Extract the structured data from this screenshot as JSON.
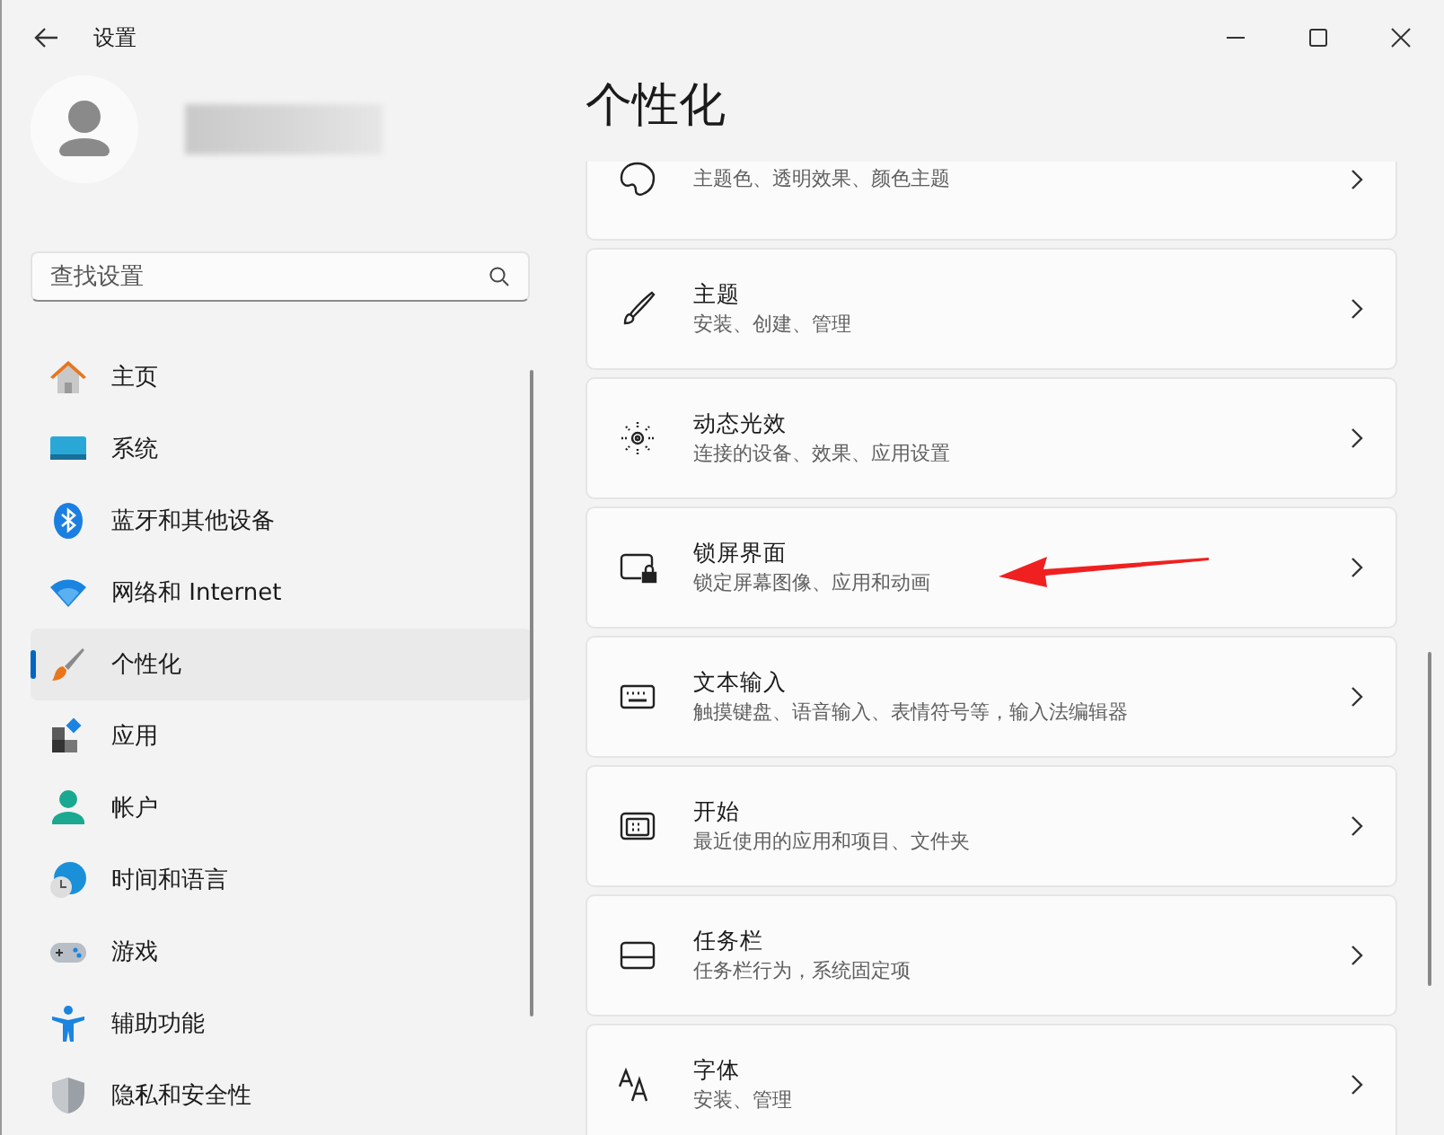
{
  "window": {
    "title": "设置"
  },
  "search": {
    "placeholder": "查找设置"
  },
  "sidebar": {
    "items": [
      {
        "label": "主页",
        "selected": false
      },
      {
        "label": "系统",
        "selected": false
      },
      {
        "label": "蓝牙和其他设备",
        "selected": false
      },
      {
        "label": "网络和 Internet",
        "selected": false
      },
      {
        "label": "个性化",
        "selected": true
      },
      {
        "label": "应用",
        "selected": false
      },
      {
        "label": "帐户",
        "selected": false
      },
      {
        "label": "时间和语言",
        "selected": false
      },
      {
        "label": "游戏",
        "selected": false
      },
      {
        "label": "辅助功能",
        "selected": false
      },
      {
        "label": "隐私和安全性",
        "selected": false
      }
    ]
  },
  "page": {
    "title": "个性化",
    "cards": [
      {
        "subtitle": "主题色、透明效果、颜色主题"
      },
      {
        "title": "主题",
        "subtitle": "安装、创建、管理"
      },
      {
        "title": "动态光效",
        "subtitle": "连接的设备、效果、应用设置"
      },
      {
        "title": "锁屏界面",
        "subtitle": "锁定屏幕图像、应用和动画"
      },
      {
        "title": "文本输入",
        "subtitle": "触摸键盘、语音输入、表情符号等，输入法编辑器"
      },
      {
        "title": "开始",
        "subtitle": "最近使用的应用和项目、文件夹"
      },
      {
        "title": "任务栏",
        "subtitle": "任务栏行为，系统固定项"
      },
      {
        "title": "字体",
        "subtitle": "安装、管理"
      }
    ]
  }
}
